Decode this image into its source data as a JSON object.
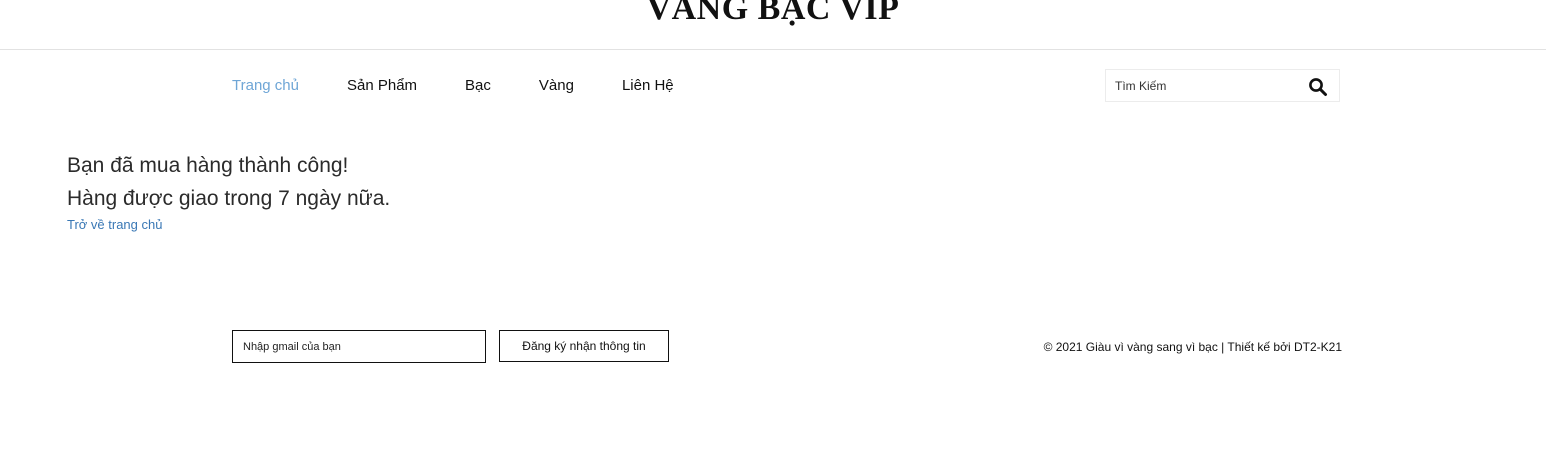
{
  "header": {
    "site_title": "VÀNG BẠC VIP"
  },
  "nav": {
    "items": [
      {
        "label": "Trang chủ",
        "active": true
      },
      {
        "label": "Sản Phẩm",
        "active": false
      },
      {
        "label": "Bạc",
        "active": false
      },
      {
        "label": "Vàng",
        "active": false
      },
      {
        "label": "Liên Hệ",
        "active": false
      }
    ],
    "active_color": "#6fa6d6"
  },
  "search": {
    "placeholder": "Tìm Kiếm",
    "icon": "search-icon"
  },
  "main": {
    "success_line1": "Bạn đã mua hàng thành công!",
    "success_line2": "Hàng được giao trong 7 ngày nữa.",
    "back_link": "Trở về trang chủ"
  },
  "footer": {
    "email_placeholder": "Nhập gmail của bạn",
    "subscribe_label": "Đăng ký nhận thông tin",
    "copyright": "© 2021 Giàu vì vàng sang vì bạc | Thiết kế bởi DT2-K21"
  }
}
